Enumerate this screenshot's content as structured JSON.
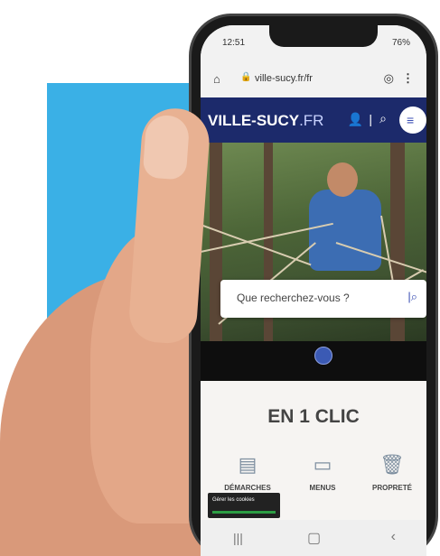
{
  "status": {
    "time": "12:51",
    "right": "76%"
  },
  "browser": {
    "url": "ville-sucy.fr/fr"
  },
  "header": {
    "logo_main": "VILLE-SUCY",
    "logo_suffix": ".FR"
  },
  "hero": {
    "search_placeholder": "Que recherchez-vous ?"
  },
  "section": {
    "title": "EN 1 CLIC",
    "quick_links": [
      {
        "label": "DÉMARCHES",
        "icon": "document-icon"
      },
      {
        "label": "MENUS",
        "icon": "menu-icon"
      },
      {
        "label": "PROPRETÉ",
        "icon": "trash-icon"
      }
    ]
  },
  "cookie": {
    "text": "Gérer les cookies"
  },
  "colors": {
    "brand": "#1c2a6b",
    "accent": "#3ab0e6",
    "link": "#3b4fb4"
  }
}
